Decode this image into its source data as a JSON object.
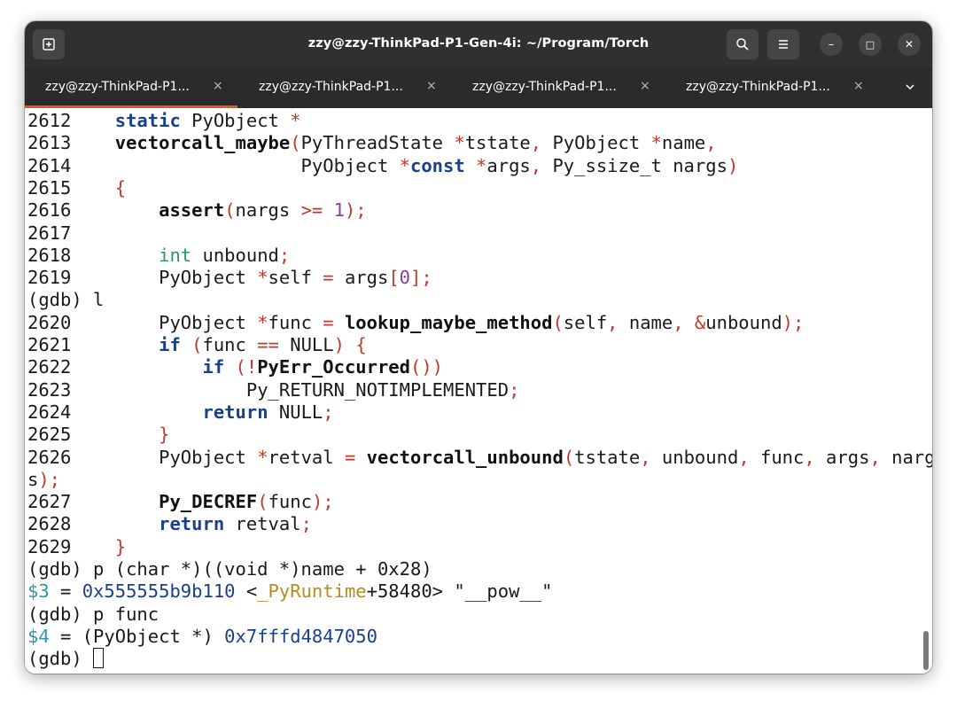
{
  "window": {
    "title": "zzy@zzy-ThinkPad-P1-Gen-4i: ~/Program/Torch",
    "buttons": {
      "new_tab_icon": "new-tab-icon",
      "search_icon": "search-icon",
      "menu_icon": "hamburger-menu-icon",
      "minimize_label": "–",
      "maximize_label": "□",
      "close_label": "✕"
    }
  },
  "tabs": [
    {
      "label": "zzy@zzy-ThinkPad-P1...",
      "close": "×",
      "active": true
    },
    {
      "label": "zzy@zzy-ThinkPad-P1...",
      "close": "×",
      "active": false
    },
    {
      "label": "zzy@zzy-ThinkPad-P1...",
      "close": "×",
      "active": false
    },
    {
      "label": "zzy@zzy-ThinkPad-P1...",
      "close": "×",
      "active": false
    }
  ],
  "terminal": {
    "lines": [
      {
        "no": "2612",
        "segs": [
          {
            "t": "    "
          },
          {
            "t": "static",
            "c": "kw"
          },
          {
            "t": " PyObject "
          },
          {
            "t": "*",
            "c": "pu"
          }
        ]
      },
      {
        "no": "2613",
        "segs": [
          {
            "t": "    "
          },
          {
            "t": "vectorcall_maybe",
            "c": "bold"
          },
          {
            "t": "(",
            "c": "pu"
          },
          {
            "t": "PyThreadState "
          },
          {
            "t": "*",
            "c": "pu"
          },
          {
            "t": "tstate"
          },
          {
            "t": ",",
            "c": "pu"
          },
          {
            "t": " PyObject "
          },
          {
            "t": "*",
            "c": "pu"
          },
          {
            "t": "name"
          },
          {
            "t": ",",
            "c": "pu"
          }
        ]
      },
      {
        "no": "2614",
        "segs": [
          {
            "t": "                     PyObject "
          },
          {
            "t": "*",
            "c": "pu"
          },
          {
            "t": "const",
            "c": "kw"
          },
          {
            "t": " "
          },
          {
            "t": "*",
            "c": "pu"
          },
          {
            "t": "args"
          },
          {
            "t": ",",
            "c": "pu"
          },
          {
            "t": " Py_ssize_t nargs"
          },
          {
            "t": ")",
            "c": "pu"
          }
        ]
      },
      {
        "no": "2615",
        "segs": [
          {
            "t": "    "
          },
          {
            "t": "{",
            "c": "pu"
          }
        ]
      },
      {
        "no": "2616",
        "segs": [
          {
            "t": "        "
          },
          {
            "t": "assert",
            "c": "bold"
          },
          {
            "t": "(",
            "c": "pu"
          },
          {
            "t": "nargs "
          },
          {
            "t": ">=",
            "c": "pu"
          },
          {
            "t": " "
          },
          {
            "t": "1",
            "c": "num"
          },
          {
            "t": ");",
            "c": "pu"
          }
        ]
      },
      {
        "no": "2617",
        "segs": []
      },
      {
        "no": "2618",
        "segs": [
          {
            "t": "        "
          },
          {
            "t": "int",
            "c": "ty"
          },
          {
            "t": " unbound"
          },
          {
            "t": ";",
            "c": "pu"
          }
        ]
      },
      {
        "no": "2619",
        "segs": [
          {
            "t": "        PyObject "
          },
          {
            "t": "*",
            "c": "pu"
          },
          {
            "t": "self "
          },
          {
            "t": "=",
            "c": "pu"
          },
          {
            "t": " args"
          },
          {
            "t": "[",
            "c": "pu"
          },
          {
            "t": "0",
            "c": "num"
          },
          {
            "t": "];",
            "c": "pu"
          }
        ]
      },
      {
        "no": "",
        "segs": [
          {
            "t": "(gdb) l"
          }
        ]
      },
      {
        "no": "2620",
        "segs": [
          {
            "t": "        PyObject "
          },
          {
            "t": "*",
            "c": "pu"
          },
          {
            "t": "func "
          },
          {
            "t": "=",
            "c": "pu"
          },
          {
            "t": " "
          },
          {
            "t": "lookup_maybe_method",
            "c": "bold"
          },
          {
            "t": "(",
            "c": "pu"
          },
          {
            "t": "self"
          },
          {
            "t": ",",
            "c": "pu"
          },
          {
            "t": " name"
          },
          {
            "t": ",",
            "c": "pu"
          },
          {
            "t": " "
          },
          {
            "t": "&",
            "c": "pu"
          },
          {
            "t": "unbound"
          },
          {
            "t": ");",
            "c": "pu"
          }
        ]
      },
      {
        "no": "2621",
        "segs": [
          {
            "t": "        "
          },
          {
            "t": "if",
            "c": "kw"
          },
          {
            "t": " "
          },
          {
            "t": "(",
            "c": "pu"
          },
          {
            "t": "func "
          },
          {
            "t": "==",
            "c": "pu"
          },
          {
            "t": " NULL"
          },
          {
            "t": ")",
            "c": "pu"
          },
          {
            "t": " "
          },
          {
            "t": "{",
            "c": "pu"
          }
        ]
      },
      {
        "no": "2622",
        "segs": [
          {
            "t": "            "
          },
          {
            "t": "if",
            "c": "kw"
          },
          {
            "t": " "
          },
          {
            "t": "(!",
            "c": "pu"
          },
          {
            "t": "PyErr_Occurred",
            "c": "bold"
          },
          {
            "t": "())",
            "c": "pu"
          }
        ]
      },
      {
        "no": "2623",
        "segs": [
          {
            "t": "                Py_RETURN_NOTIMPLEMENTED"
          },
          {
            "t": ";",
            "c": "pu"
          }
        ]
      },
      {
        "no": "2624",
        "segs": [
          {
            "t": "            "
          },
          {
            "t": "return",
            "c": "kw"
          },
          {
            "t": " NULL"
          },
          {
            "t": ";",
            "c": "pu"
          }
        ]
      },
      {
        "no": "2625",
        "segs": [
          {
            "t": "        "
          },
          {
            "t": "}",
            "c": "pu"
          }
        ]
      },
      {
        "no": "2626",
        "segs": [
          {
            "t": "        PyObject "
          },
          {
            "t": "*",
            "c": "pu"
          },
          {
            "t": "retval "
          },
          {
            "t": "=",
            "c": "pu"
          },
          {
            "t": " "
          },
          {
            "t": "vectorcall_unbound",
            "c": "bold"
          },
          {
            "t": "(",
            "c": "pu"
          },
          {
            "t": "tstate"
          },
          {
            "t": ",",
            "c": "pu"
          },
          {
            "t": " unbound"
          },
          {
            "t": ",",
            "c": "pu"
          },
          {
            "t": " func"
          },
          {
            "t": ",",
            "c": "pu"
          },
          {
            "t": " args"
          },
          {
            "t": ",",
            "c": "pu"
          },
          {
            "t": " narg"
          }
        ]
      },
      {
        "no": "",
        "segs": [
          {
            "t": "s"
          },
          {
            "t": ");",
            "c": "pu"
          }
        ]
      },
      {
        "no": "2627",
        "segs": [
          {
            "t": "        "
          },
          {
            "t": "Py_DECREF",
            "c": "bold"
          },
          {
            "t": "(",
            "c": "pu"
          },
          {
            "t": "func"
          },
          {
            "t": ");",
            "c": "pu"
          }
        ]
      },
      {
        "no": "2628",
        "segs": [
          {
            "t": "        "
          },
          {
            "t": "return",
            "c": "kw"
          },
          {
            "t": " retval"
          },
          {
            "t": ";",
            "c": "pu"
          }
        ]
      },
      {
        "no": "2629",
        "segs": [
          {
            "t": "    "
          },
          {
            "t": "}",
            "c": "pu"
          }
        ]
      },
      {
        "no": "",
        "segs": [
          {
            "t": "(gdb) p (char *)((void *)name + 0x28)"
          }
        ]
      },
      {
        "no": "",
        "segs": [
          {
            "t": "$3",
            "c": "cy"
          },
          {
            "t": " = "
          },
          {
            "t": "0x555555b9b110",
            "c": "addr"
          },
          {
            "t": " <"
          },
          {
            "t": "_PyRuntime",
            "c": "sym"
          },
          {
            "t": "+58480> \"__pow__\""
          }
        ]
      },
      {
        "no": "",
        "segs": [
          {
            "t": "(gdb) p func"
          }
        ]
      },
      {
        "no": "",
        "segs": [
          {
            "t": "$4",
            "c": "cy"
          },
          {
            "t": " = (PyObject *) "
          },
          {
            "t": "0x7fffd4847050",
            "c": "addr"
          }
        ]
      },
      {
        "no": "",
        "segs": [
          {
            "t": "(gdb) "
          }
        ],
        "cursor": true
      }
    ]
  },
  "colors": {
    "titlebar_bg": "#303030",
    "tabbar_bg": "#2b2b2b",
    "active_tab_accent": "#e95420",
    "terminal_bg": "#ffffff",
    "keyword": "#1c3f8a",
    "punctuation": "#c0392b",
    "number": "#8e3b9c",
    "type": "#2a9a64"
  }
}
